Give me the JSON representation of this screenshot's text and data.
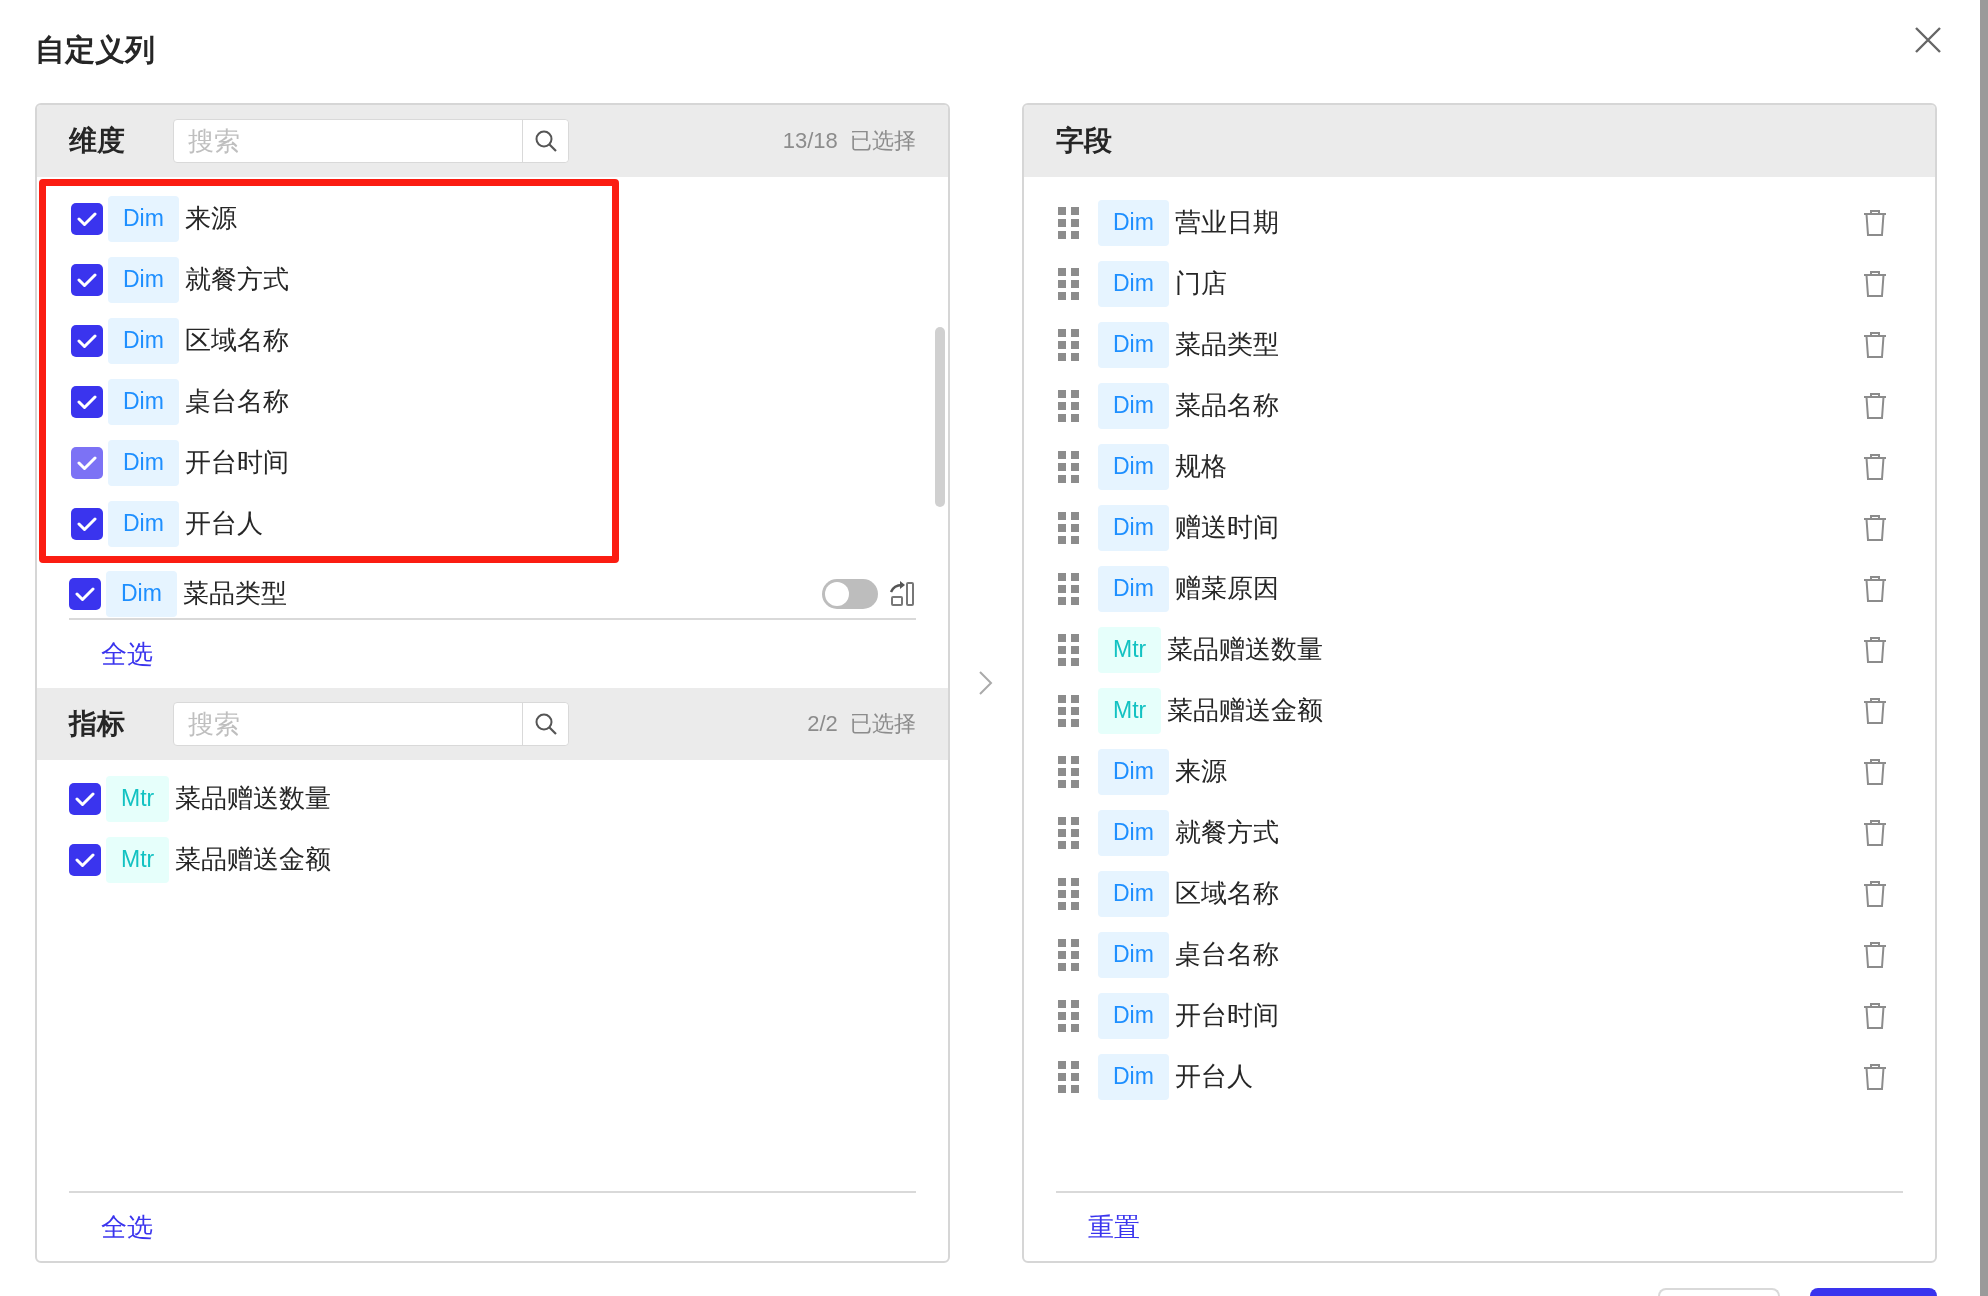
{
  "dialog": {
    "title": "自定义列"
  },
  "dimensions": {
    "title": "维度",
    "search": {
      "placeholder": "搜索"
    },
    "count": "13/18",
    "count_label": "已选择",
    "select_all": "全选",
    "highlighted_items": [
      {
        "kind": "dim",
        "tag": "Dim",
        "label": "来源",
        "checked": true,
        "disabled": false
      },
      {
        "kind": "dim",
        "tag": "Dim",
        "label": "就餐方式",
        "checked": true,
        "disabled": false
      },
      {
        "kind": "dim",
        "tag": "Dim",
        "label": "区域名称",
        "checked": true,
        "disabled": false
      },
      {
        "kind": "dim",
        "tag": "Dim",
        "label": "桌台名称",
        "checked": true,
        "disabled": false
      },
      {
        "kind": "dim",
        "tag": "Dim",
        "label": "开台时间",
        "checked": true,
        "disabled": true
      },
      {
        "kind": "dim",
        "tag": "Dim",
        "label": "开台人",
        "checked": true,
        "disabled": false
      }
    ],
    "items": [
      {
        "kind": "dim",
        "tag": "Dim",
        "label": "菜品类型",
        "checked": true,
        "disabled": false,
        "toggle": {
          "on": false
        }
      }
    ]
  },
  "metrics": {
    "title": "指标",
    "search": {
      "placeholder": "搜索"
    },
    "count": "2/2",
    "count_label": "已选择",
    "select_all": "全选",
    "items": [
      {
        "kind": "mtr",
        "tag": "Mtr",
        "label": "菜品赠送数量",
        "checked": true,
        "disabled": false
      },
      {
        "kind": "mtr",
        "tag": "Mtr",
        "label": "菜品赠送金额",
        "checked": true,
        "disabled": false
      }
    ]
  },
  "fields": {
    "title": "字段",
    "reset": "重置",
    "items": [
      {
        "kind": "dim",
        "tag": "Dim",
        "label": "营业日期"
      },
      {
        "kind": "dim",
        "tag": "Dim",
        "label": "门店"
      },
      {
        "kind": "dim",
        "tag": "Dim",
        "label": "菜品类型"
      },
      {
        "kind": "dim",
        "tag": "Dim",
        "label": "菜品名称"
      },
      {
        "kind": "dim",
        "tag": "Dim",
        "label": "规格"
      },
      {
        "kind": "dim",
        "tag": "Dim",
        "label": "赠送时间"
      },
      {
        "kind": "dim",
        "tag": "Dim",
        "label": "赠菜原因"
      },
      {
        "kind": "mtr",
        "tag": "Mtr",
        "label": "菜品赠送数量"
      },
      {
        "kind": "mtr",
        "tag": "Mtr",
        "label": "菜品赠送金额"
      },
      {
        "kind": "dim",
        "tag": "Dim",
        "label": "来源"
      },
      {
        "kind": "dim",
        "tag": "Dim",
        "label": "就餐方式"
      },
      {
        "kind": "dim",
        "tag": "Dim",
        "label": "区域名称"
      },
      {
        "kind": "dim",
        "tag": "Dim",
        "label": "桌台名称"
      },
      {
        "kind": "dim",
        "tag": "Dim",
        "label": "开台时间"
      },
      {
        "kind": "dim",
        "tag": "Dim",
        "label": "开台人"
      }
    ]
  }
}
